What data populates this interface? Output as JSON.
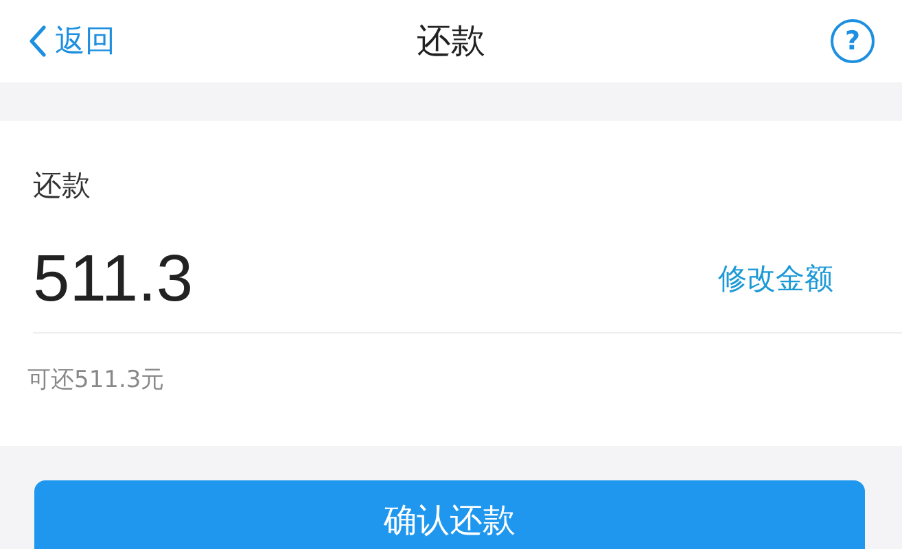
{
  "nav": {
    "back_label": "返回",
    "title": "还款",
    "help_icon": "?"
  },
  "card": {
    "label": "还款",
    "amount": "511.3",
    "edit_link": "修改金额",
    "available": "可还511.3元"
  },
  "confirm_button": "确认还款"
}
